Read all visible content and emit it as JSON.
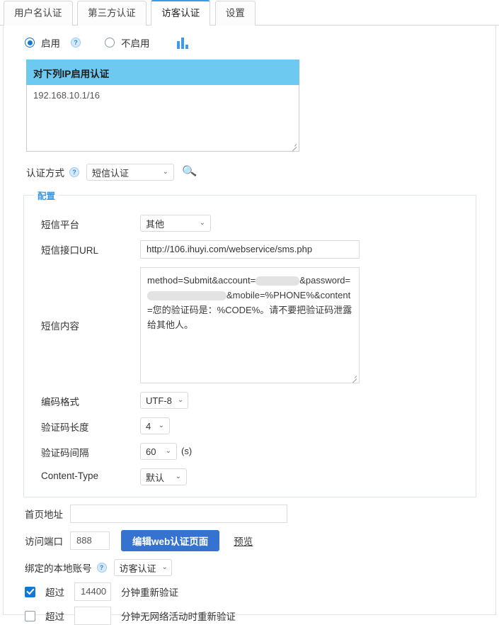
{
  "tabs": [
    {
      "label": "用户名认证",
      "active": false
    },
    {
      "label": "第三方认证",
      "active": false
    },
    {
      "label": "访客认证",
      "active": true
    },
    {
      "label": "设置",
      "active": false
    }
  ],
  "enable_row": {
    "enabled_label": "启用",
    "disabled_label": "不启用",
    "help": "?",
    "selected": "启用",
    "chart_icon": "bar-chart-icon"
  },
  "ip_box": {
    "header": "对下列IP启用认证",
    "value": "192.168.10.1/16"
  },
  "auth_method": {
    "label": "认证方式",
    "help": "?",
    "selected": "短信认证",
    "caret": "⌄",
    "search_icon": "🔍"
  },
  "config": {
    "legend": "配置",
    "platform": {
      "label": "短信平台",
      "selected": "其他",
      "caret": "⌄"
    },
    "url": {
      "label": "短信接口URL",
      "value": "http://106.ihuyi.com/webservice/sms.php"
    },
    "sms_content": {
      "label": "短信内容",
      "part1": "method=Submit&account=",
      "part2": "&password=",
      "part3": "&mobile=%PHONE%&content=您的验证码是：%CODE%。请不要把验证码泄露给其他人。",
      "account_redacted": true,
      "password_redacted": true
    },
    "encoding": {
      "label": "编码格式",
      "selected": "UTF-8",
      "caret": "⌄"
    },
    "code_length": {
      "label": "验证码长度",
      "selected": "4",
      "caret": "⌄"
    },
    "code_interval": {
      "label": "验证码间隔",
      "selected": "60",
      "caret": "⌄",
      "unit": "(s)"
    },
    "content_type": {
      "label": "Content-Type",
      "selected": "默认",
      "caret": "⌄"
    }
  },
  "bottom": {
    "home_url": {
      "label": "首页地址",
      "value": "",
      "placeholder": ""
    },
    "port": {
      "label": "访问端口",
      "value": "888"
    },
    "edit_page_button": "编辑web认证页面",
    "preview_link": "预览",
    "bind_account": {
      "label": "绑定的本地账号",
      "help": "?",
      "selected": "访客认证",
      "caret": "⌄"
    },
    "recheck_time": {
      "checked": true,
      "prefix": "超过",
      "value": "14400",
      "suffix": "分钟重新验证"
    },
    "recheck_idle": {
      "checked": false,
      "prefix": "超过",
      "value": "",
      "suffix": "分钟无网络活动时重新验证"
    }
  },
  "colors": {
    "accent": "#3d9ae3",
    "primary_button": "#3672d0",
    "ip_header": "#6ec9f0",
    "radio_checked": "#1278d4"
  }
}
